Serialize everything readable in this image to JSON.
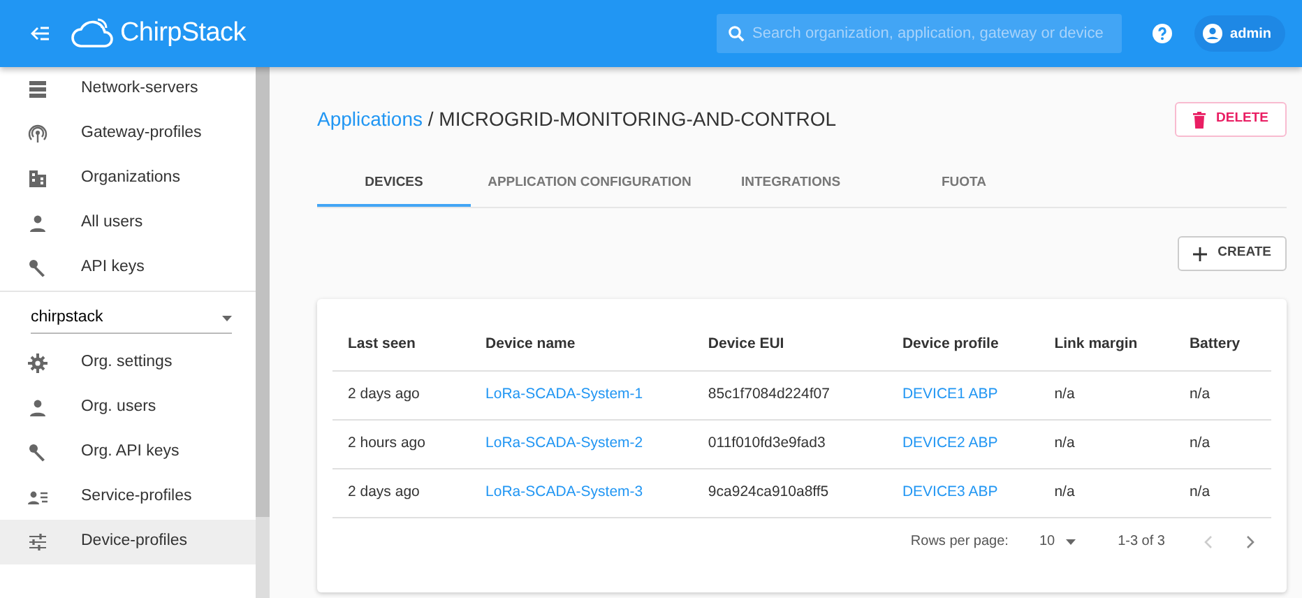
{
  "topbar": {
    "brand": "ChirpStack",
    "search": {
      "placeholder": "Search organization, application, gateway or device"
    },
    "user": "admin"
  },
  "sidebar": {
    "admin_items": [
      {
        "label": "Network-servers",
        "selected": false
      },
      {
        "label": "Gateway-profiles",
        "selected": false
      },
      {
        "label": "Organizations",
        "selected": false
      },
      {
        "label": "All users",
        "selected": false
      },
      {
        "label": "API keys",
        "selected": false
      }
    ],
    "organization_select": "chirpstack",
    "org_items": [
      {
        "label": "Org. settings",
        "selected": false
      },
      {
        "label": "Org. users",
        "selected": false
      },
      {
        "label": "Org. API keys",
        "selected": false
      },
      {
        "label": "Service-profiles",
        "selected": false
      },
      {
        "label": "Device-profiles",
        "selected": true
      }
    ]
  },
  "breadcrumb": {
    "parent": "Applications",
    "separator": "/",
    "current": "MICROGRID-MONITORING-AND-CONTROL"
  },
  "delete_button": "DELETE",
  "tabs": [
    {
      "label": "DEVICES",
      "selected": true
    },
    {
      "label": "APPLICATION CONFIGURATION",
      "selected": false
    },
    {
      "label": "INTEGRATIONS",
      "selected": false
    },
    {
      "label": "FUOTA",
      "selected": false
    }
  ],
  "create_button": "CREATE",
  "table": {
    "columns": [
      "Last seen",
      "Device name",
      "Device EUI",
      "Device profile",
      "Link margin",
      "Battery"
    ],
    "rows": [
      [
        "2 days ago",
        "LoRa-SCADA-System-1",
        "85c1f7084d224f07",
        "DEVICE1 ABP",
        "n/a",
        "n/a"
      ],
      [
        "2 hours ago",
        "LoRa-SCADA-System-2",
        "011f010fd3e9fad3",
        "DEVICE2 ABP",
        "n/a",
        "n/a"
      ],
      [
        "2 days ago",
        "LoRa-SCADA-System-3",
        "9ca924ca910a8ff5",
        "DEVICE3 ABP",
        "n/a",
        "n/a"
      ]
    ]
  },
  "pagination": {
    "rows_per_page_label": "Rows per page:",
    "rows_per_page": "10",
    "range": "1-3 of 3",
    "previous_disabled": true,
    "next_disabled": false
  }
}
